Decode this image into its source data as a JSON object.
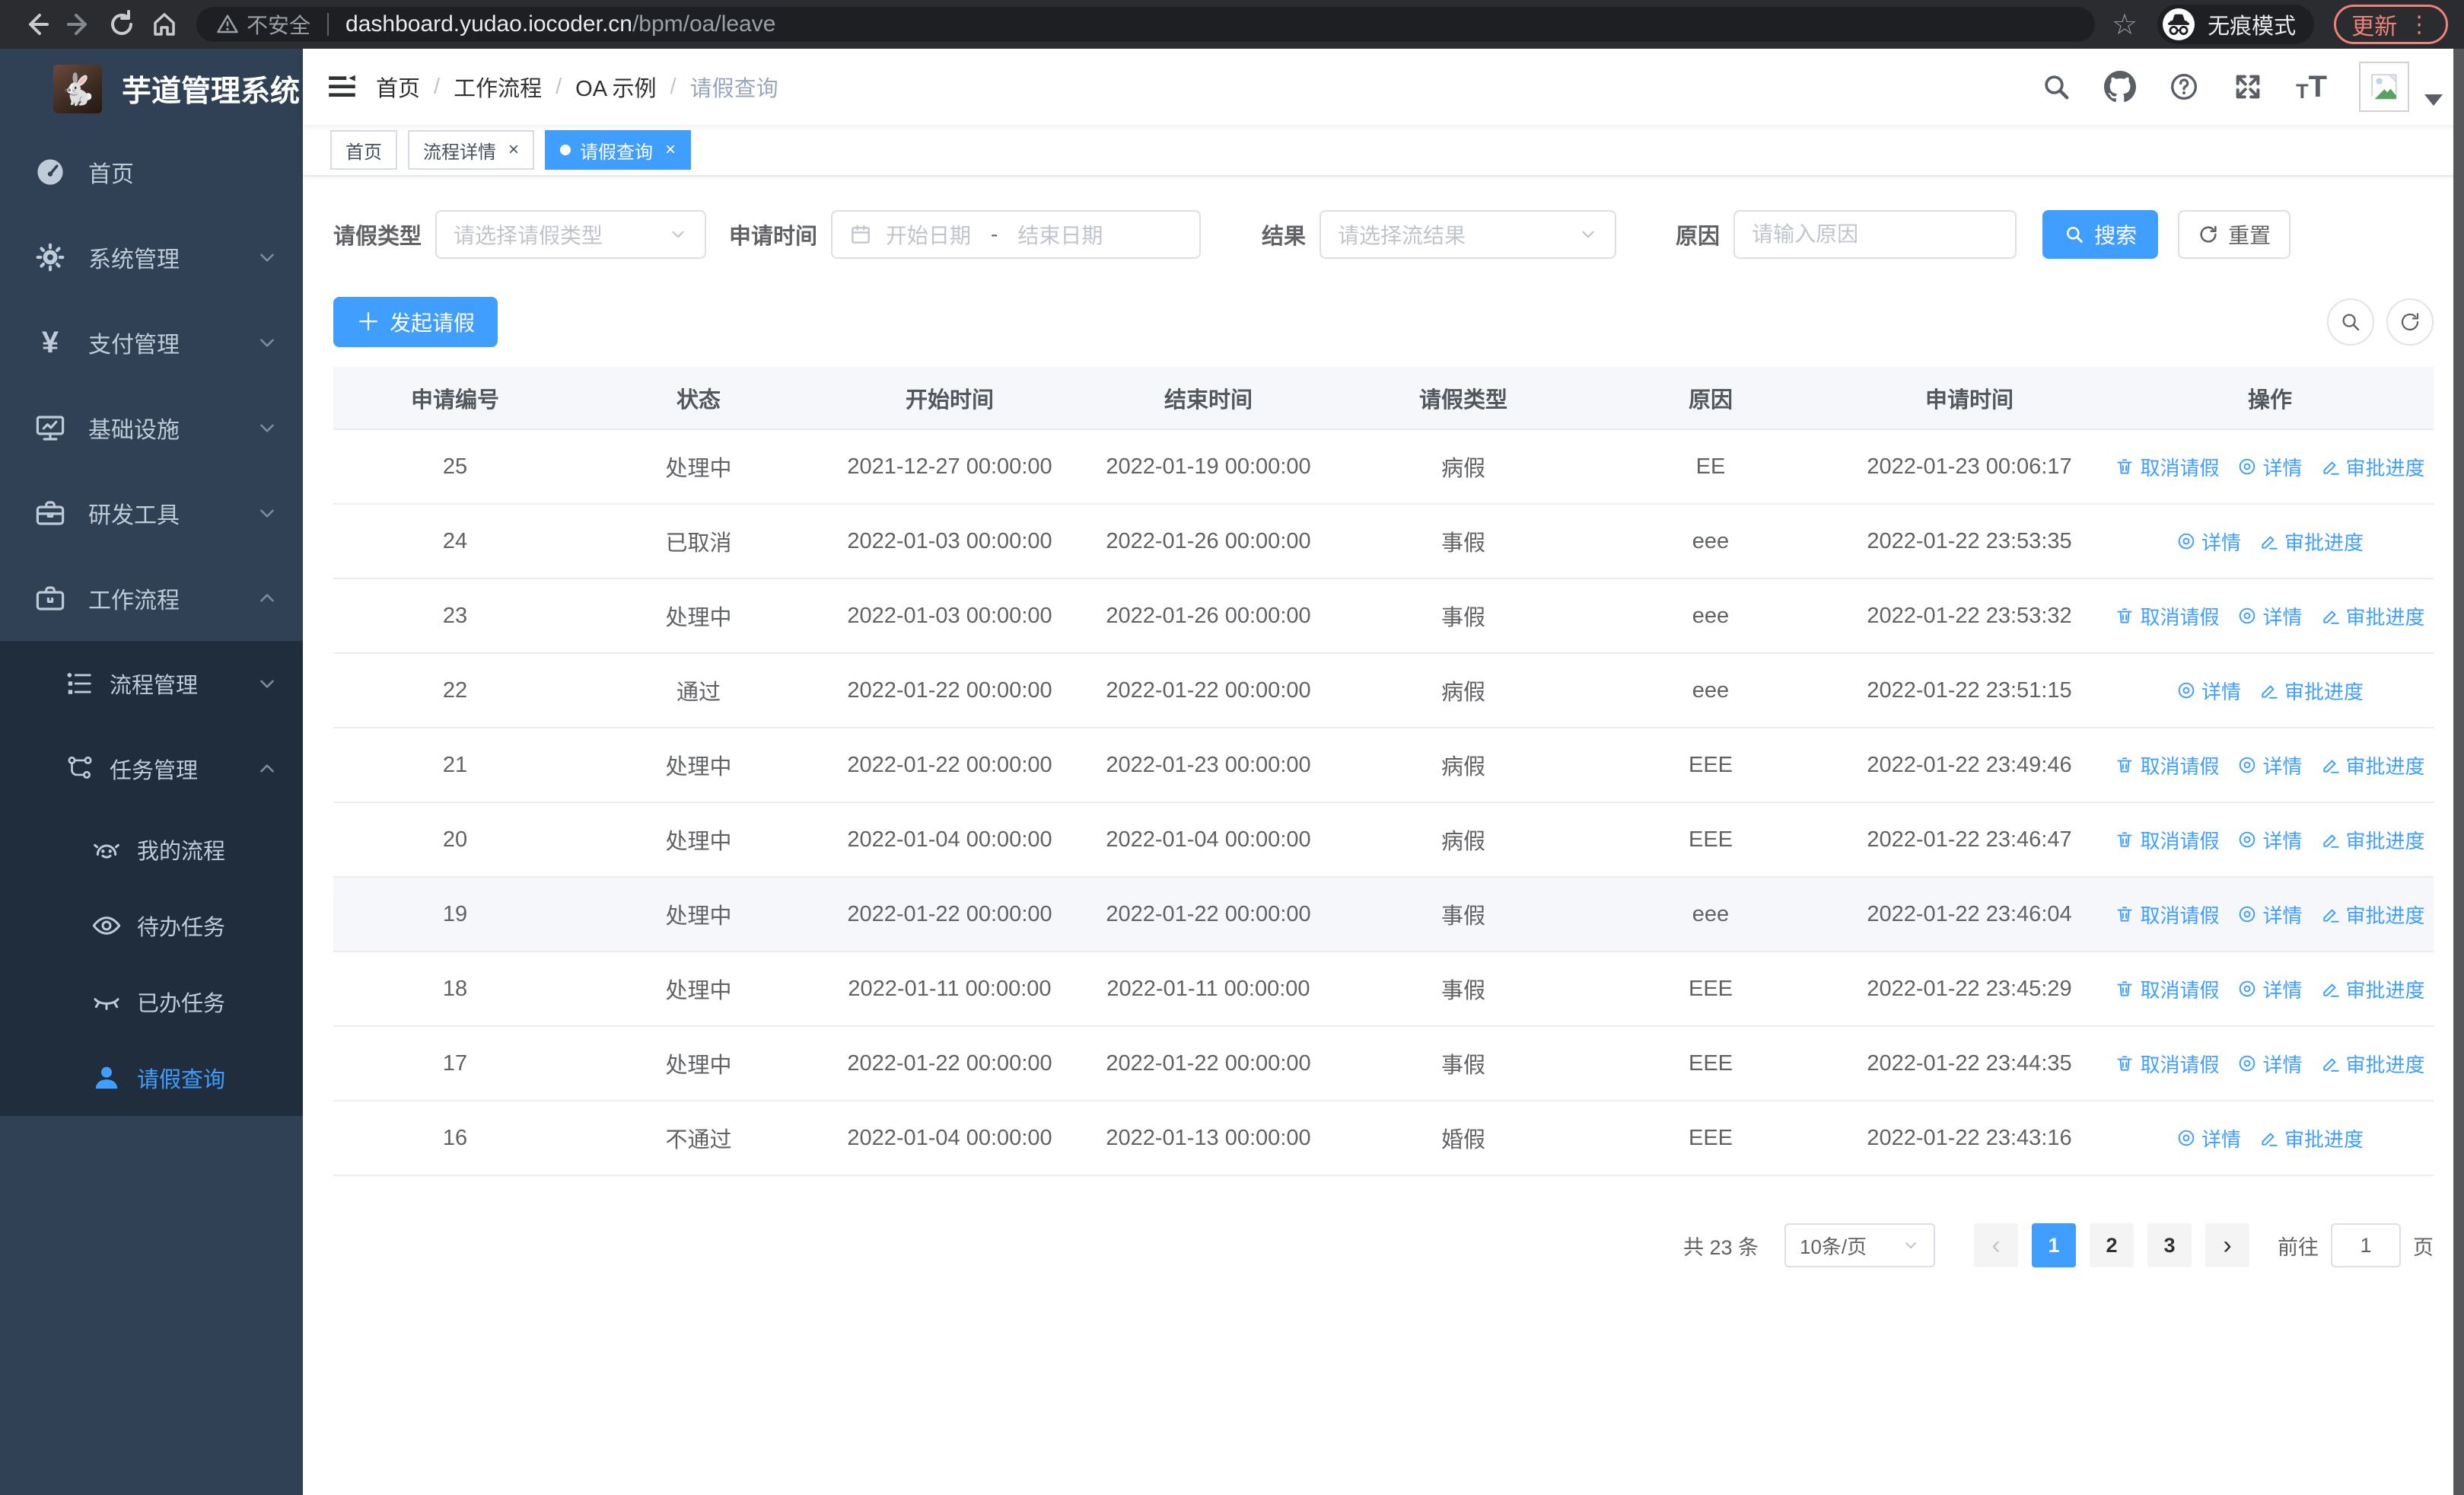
{
  "browser": {
    "not_secure": "不安全",
    "url_domain": "dashboard.yudao.iocoder.cn",
    "url_path": "/bpm/oa/leave",
    "incognito_label": "无痕模式",
    "update_label": "更新"
  },
  "sidebar": {
    "title": "芋道管理系统",
    "items": [
      {
        "label": "首页"
      },
      {
        "label": "系统管理"
      },
      {
        "label": "支付管理"
      },
      {
        "label": "基础设施"
      },
      {
        "label": "研发工具"
      },
      {
        "label": "工作流程"
      },
      {
        "label": "流程管理"
      },
      {
        "label": "任务管理"
      },
      {
        "label": "我的流程"
      },
      {
        "label": "待办任务"
      },
      {
        "label": "已办任务"
      },
      {
        "label": "请假查询"
      }
    ]
  },
  "breadcrumb": [
    "首页",
    "工作流程",
    "OA 示例",
    "请假查询"
  ],
  "tabs": [
    {
      "label": "首页"
    },
    {
      "label": "流程详情"
    },
    {
      "label": "请假查询"
    }
  ],
  "filters": {
    "leave_type": {
      "label": "请假类型",
      "placeholder": "请选择请假类型"
    },
    "apply_time": {
      "label": "申请时间",
      "start_placeholder": "开始日期",
      "separator": "-",
      "end_placeholder": "结束日期"
    },
    "result": {
      "label": "结果",
      "placeholder": "请选择流结果"
    },
    "reason": {
      "label": "原因",
      "placeholder": "请输入原因"
    },
    "search_label": "搜索",
    "reset_label": "重置"
  },
  "toolbar": {
    "create_label": "发起请假"
  },
  "table": {
    "columns": [
      "申请编号",
      "状态",
      "开始时间",
      "结束时间",
      "请假类型",
      "原因",
      "申请时间",
      "操作"
    ],
    "action_labels": {
      "cancel": "取消请假",
      "detail": "详情",
      "progress": "审批进度"
    },
    "rows": [
      {
        "id": "25",
        "status": "处理中",
        "start": "2021-12-27 00:00:00",
        "end": "2022-01-19 00:00:00",
        "type": "病假",
        "reason": "EE",
        "apply": "2022-01-23 00:06:17",
        "actions": [
          "cancel",
          "detail",
          "progress"
        ],
        "highlight": false
      },
      {
        "id": "24",
        "status": "已取消",
        "start": "2022-01-03 00:00:00",
        "end": "2022-01-26 00:00:00",
        "type": "事假",
        "reason": "eee",
        "apply": "2022-01-22 23:53:35",
        "actions": [
          "detail",
          "progress"
        ],
        "highlight": false
      },
      {
        "id": "23",
        "status": "处理中",
        "start": "2022-01-03 00:00:00",
        "end": "2022-01-26 00:00:00",
        "type": "事假",
        "reason": "eee",
        "apply": "2022-01-22 23:53:32",
        "actions": [
          "cancel",
          "detail",
          "progress"
        ],
        "highlight": false
      },
      {
        "id": "22",
        "status": "通过",
        "start": "2022-01-22 00:00:00",
        "end": "2022-01-22 00:00:00",
        "type": "病假",
        "reason": "eee",
        "apply": "2022-01-22 23:51:15",
        "actions": [
          "detail",
          "progress"
        ],
        "highlight": false
      },
      {
        "id": "21",
        "status": "处理中",
        "start": "2022-01-22 00:00:00",
        "end": "2022-01-23 00:00:00",
        "type": "病假",
        "reason": "EEE",
        "apply": "2022-01-22 23:49:46",
        "actions": [
          "cancel",
          "detail",
          "progress"
        ],
        "highlight": false
      },
      {
        "id": "20",
        "status": "处理中",
        "start": "2022-01-04 00:00:00",
        "end": "2022-01-04 00:00:00",
        "type": "病假",
        "reason": "EEE",
        "apply": "2022-01-22 23:46:47",
        "actions": [
          "cancel",
          "detail",
          "progress"
        ],
        "highlight": false
      },
      {
        "id": "19",
        "status": "处理中",
        "start": "2022-01-22 00:00:00",
        "end": "2022-01-22 00:00:00",
        "type": "事假",
        "reason": "eee",
        "apply": "2022-01-22 23:46:04",
        "actions": [
          "cancel",
          "detail",
          "progress"
        ],
        "highlight": true
      },
      {
        "id": "18",
        "status": "处理中",
        "start": "2022-01-11 00:00:00",
        "end": "2022-01-11 00:00:00",
        "type": "事假",
        "reason": "EEE",
        "apply": "2022-01-22 23:45:29",
        "actions": [
          "cancel",
          "detail",
          "progress"
        ],
        "highlight": false
      },
      {
        "id": "17",
        "status": "处理中",
        "start": "2022-01-22 00:00:00",
        "end": "2022-01-22 00:00:00",
        "type": "事假",
        "reason": "EEE",
        "apply": "2022-01-22 23:44:35",
        "actions": [
          "cancel",
          "detail",
          "progress"
        ],
        "highlight": false
      },
      {
        "id": "16",
        "status": "不通过",
        "start": "2022-01-04 00:00:00",
        "end": "2022-01-13 00:00:00",
        "type": "婚假",
        "reason": "EEE",
        "apply": "2022-01-22 23:43:16",
        "actions": [
          "detail",
          "progress"
        ],
        "highlight": false
      }
    ]
  },
  "pagination": {
    "total_text": "共 23 条",
    "page_size": "10条/页",
    "pages": [
      "1",
      "2",
      "3"
    ],
    "goto_label": "前往",
    "goto_value": "1",
    "page_suffix": "页"
  },
  "colors": {
    "primary": "#409eff",
    "sidebar_bg": "#304156",
    "submenu_bg": "#1f2d3d",
    "update_accent": "#ee8277"
  }
}
